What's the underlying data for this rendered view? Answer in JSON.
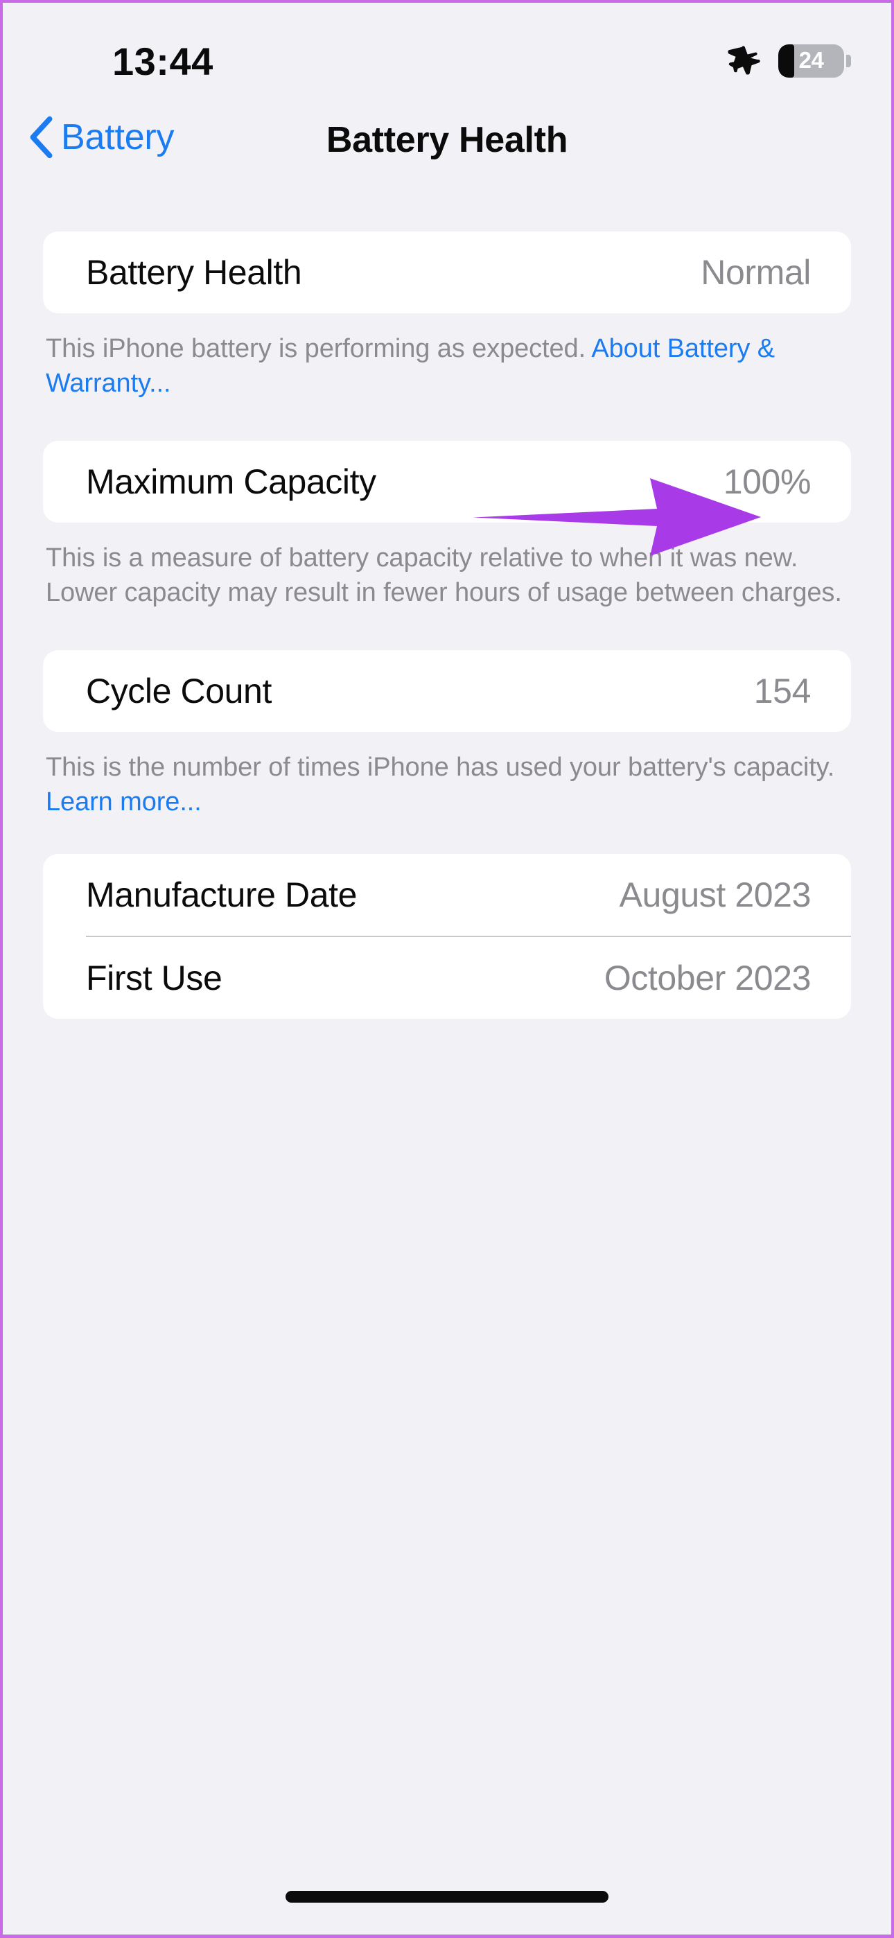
{
  "status_bar": {
    "time": "13:44",
    "airplane_icon": "airplane-icon",
    "battery_level": "24",
    "battery_percent": 24
  },
  "nav": {
    "back_label": "Battery",
    "back_icon": "chevron-left-icon",
    "title": "Battery Health"
  },
  "sections": [
    {
      "rows": [
        {
          "label": "Battery Health",
          "value": "Normal"
        }
      ],
      "footnote_text": "This iPhone battery is performing as expected. ",
      "footnote_link": "About Battery & Warranty..."
    },
    {
      "rows": [
        {
          "label": "Maximum Capacity",
          "value": "100%"
        }
      ],
      "footnote_text": "This is a measure of battery capacity relative to when it was new. Lower capacity may result in fewer hours of usage between charges.",
      "footnote_link": ""
    },
    {
      "rows": [
        {
          "label": "Cycle Count",
          "value": "154"
        }
      ],
      "footnote_text": "This is the number of times iPhone has used your battery's capacity. ",
      "footnote_link": "Learn more..."
    },
    {
      "rows": [
        {
          "label": "Manufacture Date",
          "value": "August 2023"
        },
        {
          "label": "First Use",
          "value": "October 2023"
        }
      ],
      "footnote_text": "",
      "footnote_link": ""
    }
  ],
  "annotation": {
    "arrow_color": "#a83ae8",
    "points_to": "100%"
  },
  "colors": {
    "background": "#f1f1f6",
    "card": "#ffffff",
    "accent_blue": "#1a7cf0",
    "secondary_text": "#8a8a8f",
    "frame_border": "#c96ae8"
  }
}
